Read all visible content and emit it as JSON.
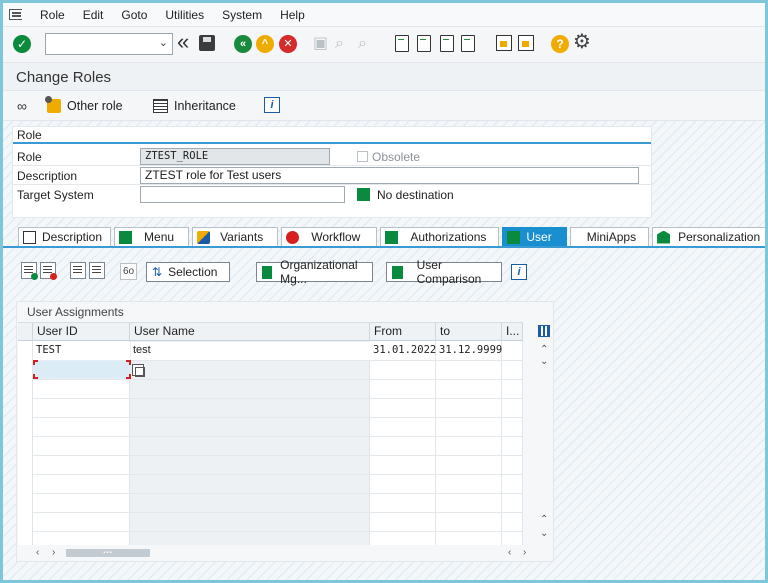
{
  "menubar": {
    "items": [
      "Role",
      "Edit",
      "Goto",
      "Utilities",
      "System",
      "Help"
    ],
    "mnemonics": [
      "R",
      "E",
      "G",
      "s",
      "S",
      "H"
    ]
  },
  "toolbar": {
    "command_field_value": "",
    "icons": [
      "check-icon",
      "dropdown-icon",
      "double-left-icon",
      "save-icon",
      "back-icon",
      "exit-icon",
      "cancel-icon",
      "print-icon",
      "find-icon",
      "find-next-icon",
      "first-page-icon",
      "previous-page-icon",
      "next-page-icon",
      "last-page-icon",
      "new-session-icon",
      "shortcut-icon",
      "help-icon",
      "settings-icon"
    ]
  },
  "title": "Change Roles",
  "app_toolbar": {
    "other_role": "Other role",
    "inheritance": "Inheritance",
    "info": "i"
  },
  "role_group": {
    "title": "Role",
    "role_label": "Role",
    "role_value": "ZTEST_ROLE",
    "obsolete_label": "Obsolete",
    "description_label": "Description",
    "description_value": "ZTEST role for Test users",
    "target_system_label": "Target System",
    "target_system_value": "",
    "no_destination_label": "No destination"
  },
  "tabs": [
    {
      "label": "Description",
      "icon": "document-icon"
    },
    {
      "label": "Menu",
      "icon": "menu-status-icon"
    },
    {
      "label": "Variants",
      "icon": "variants-icon"
    },
    {
      "label": "Workflow",
      "icon": "workflow-status-icon"
    },
    {
      "label": "Authorizations",
      "icon": "authorizations-status-icon"
    },
    {
      "label": "User",
      "icon": "user-status-icon",
      "active": true
    },
    {
      "label": "MiniApps",
      "icon": ""
    },
    {
      "label": "Personalization",
      "icon": "personalization-icon"
    }
  ],
  "user_tab": {
    "selection_button": "Selection",
    "org_mgmt_button": "Organizational Mg...",
    "user_comparison_button": "User Comparison",
    "info": "i",
    "oo_label": "6o"
  },
  "user_assignments": {
    "title": "User Assignments",
    "columns": [
      "User ID",
      "User Name",
      "From",
      "to",
      "I..."
    ],
    "rows": [
      {
        "user_id": "TEST",
        "user_name": "test",
        "from": "31.01.2022",
        "to": "31.12.9999"
      }
    ]
  },
  "colors": {
    "status_green": "#0a8a3e",
    "accent_blue": "#1a8fd0",
    "status_red": "#d61f1f",
    "help_yellow": "#f0ab00"
  }
}
